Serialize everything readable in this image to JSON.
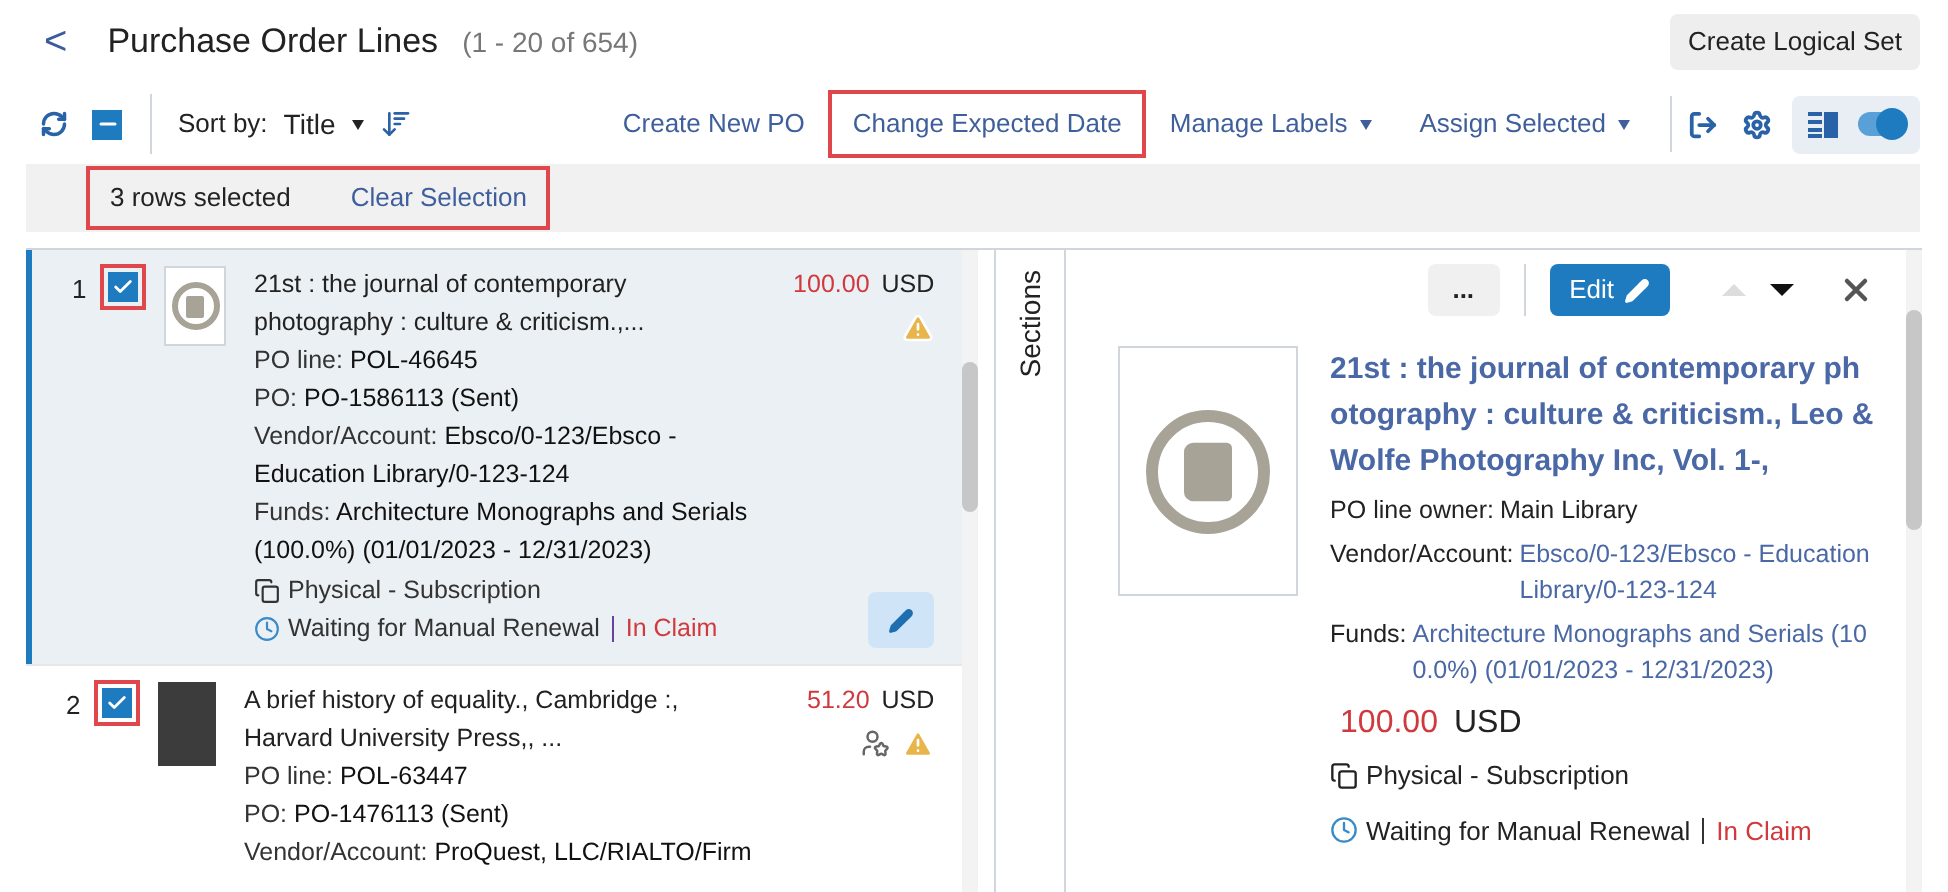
{
  "header": {
    "back": "<",
    "title": "Purchase Order Lines",
    "count": "(1 - 20 of 654)",
    "button": "Create Logical Set"
  },
  "toolbar": {
    "sort_label": "Sort by:",
    "sort_value": "Title",
    "select_all_checked": true,
    "layout_toggle_on": true,
    "actions": [
      {
        "label": "Create New PO",
        "dropdown": false,
        "highlighted": false
      },
      {
        "label": "Change Expected Date",
        "dropdown": false,
        "highlighted": true
      },
      {
        "label": "Manage Labels",
        "dropdown": true,
        "highlighted": false
      },
      {
        "label": "Assign Selected",
        "dropdown": true,
        "highlighted": false
      }
    ]
  },
  "selection_bar": {
    "count": "3 rows selected",
    "clear": "Clear Selection",
    "highlighted": true
  },
  "rows": [
    {
      "number": "1",
      "checked": true,
      "highlighted": true,
      "selected": true,
      "kind": "icon",
      "title": "21st : the journal of contemporary photography : culture & criticism.,...",
      "price": "100.00",
      "currency": "USD",
      "assigned": false,
      "warning": true,
      "fields": [
        {
          "label": "PO line:",
          "value": "POL-46645"
        },
        {
          "label": "PO:",
          "value": "PO-1586113 (Sent)"
        },
        {
          "label": "Vendor/Account:",
          "value": "Ebsco/0-123/Ebsco - Education Library/0-123-124"
        },
        {
          "label": "Funds:",
          "value": "Architecture Monographs and Serials (100.0%) (01/01/2023 - 12/31/2023)"
        }
      ],
      "format": "Physical - Subscription",
      "status": "Waiting for Manual Renewal",
      "claim": "In Claim"
    },
    {
      "number": "2",
      "checked": true,
      "highlighted": true,
      "selected": false,
      "kind": "cover",
      "title": "A brief history of equality., Cambridge :, Harvard University Press,, ...",
      "price": "51.20",
      "currency": "USD",
      "assigned": true,
      "warning": true,
      "fields": [
        {
          "label": "PO line:",
          "value": "POL-63447"
        },
        {
          "label": "PO:",
          "value": "PO-1476113 (Sent)"
        },
        {
          "label": "Vendor/Account:",
          "value": "ProQuest, LLC/RIALTO/Firm"
        }
      ]
    }
  ],
  "sections_tab": "Sections",
  "detail": {
    "more": "...",
    "edit": "Edit",
    "title": "21st : the journal of contemporary photography : culture & criticism., Leo & Wolfe Photography Inc, Vol. 1-,",
    "fields": [
      {
        "label": "PO line owner:",
        "value": "Main Library",
        "link": false
      },
      {
        "label": "Vendor/Account:",
        "value": "Ebsco/0-123/Ebsco - Education Library/0-123-124",
        "link": true
      },
      {
        "label": "Funds:",
        "value": "Architecture Monographs and Serials (100.0%) (01/01/2023 - 12/31/2023)",
        "link": true
      }
    ],
    "price": "100.00",
    "currency": "USD",
    "format": "Physical - Subscription",
    "status": "Waiting for Manual Renewal",
    "claim": "In Claim"
  }
}
